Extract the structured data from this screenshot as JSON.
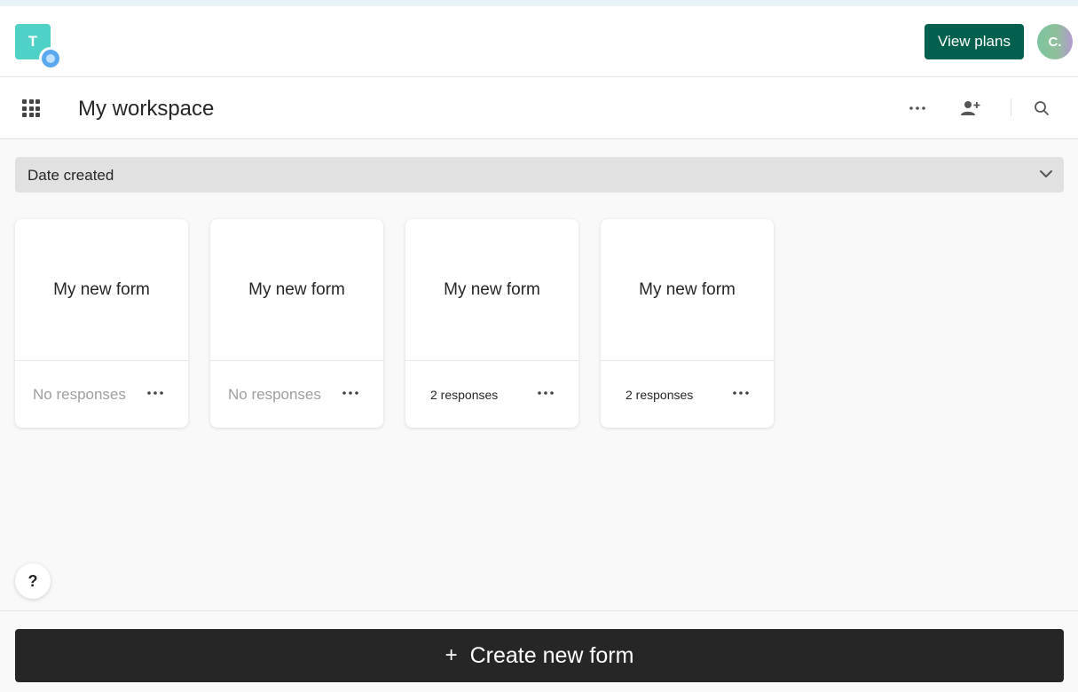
{
  "header": {
    "workspace_initial": "T",
    "view_plans_label": "View plans",
    "avatar_initial": "C."
  },
  "toolbar": {
    "title": "My workspace",
    "icons": [
      "apps-grid-icon",
      "more-icon",
      "add-person-icon",
      "search-icon"
    ]
  },
  "sort": {
    "label": "Date created"
  },
  "forms": [
    {
      "title": "My new form",
      "responses": "No responses"
    },
    {
      "title": "My new form",
      "responses": "No responses"
    },
    {
      "title": "My new form",
      "responses": "2 responses"
    },
    {
      "title": "My new form",
      "responses": "2 responses"
    }
  ],
  "help": {
    "label": "?"
  },
  "create": {
    "label": "Create new form",
    "icon": "+"
  },
  "colors": {
    "brand_green": "#02614e",
    "create_button": "#262626",
    "workspace_badge": "#4fd1c5"
  }
}
